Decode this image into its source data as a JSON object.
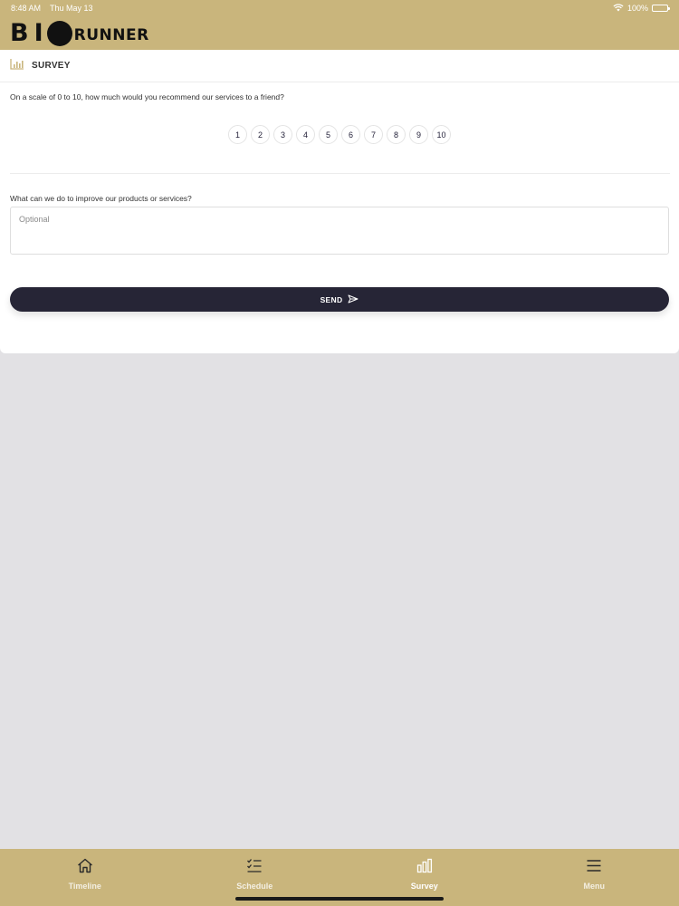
{
  "status": {
    "time": "8:48 AM",
    "date": "Thu May 13",
    "battery": "100%",
    "battery_level": 1.0
  },
  "brand": {
    "logo_text_1": "BI",
    "logo_text_2": "RUNNER",
    "header_color": "#c9b57c"
  },
  "survey": {
    "title": "SURVEY",
    "question1": "On a scale of 0 to 10, how much would you recommend our services to a friend?",
    "scale": [
      "1",
      "2",
      "3",
      "4",
      "5",
      "6",
      "7",
      "8",
      "9",
      "10"
    ],
    "question2": "What can we do to improve our products or services?",
    "feedback_placeholder": "Optional",
    "feedback_value": "",
    "send_label": "SEND"
  },
  "tabs": [
    {
      "label": "Timeline",
      "icon": "home-icon",
      "active": false
    },
    {
      "label": "Schedule",
      "icon": "checklist-icon",
      "active": false
    },
    {
      "label": "Survey",
      "icon": "bar-chart-icon",
      "active": true
    },
    {
      "label": "Menu",
      "icon": "menu-icon",
      "active": false
    }
  ],
  "colors": {
    "accent": "#c9b57c",
    "button": "#262536",
    "background": "#e2e1e4"
  }
}
